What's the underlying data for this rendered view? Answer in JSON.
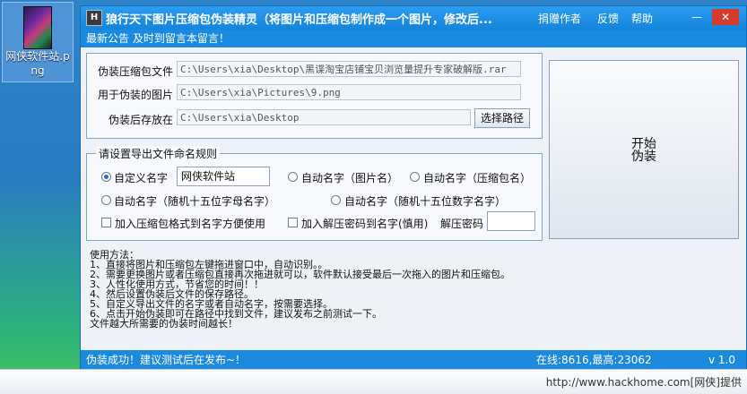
{
  "desktop": {
    "icon_label": "网侠软件站.png"
  },
  "window": {
    "title": "狼行天下图片压缩包伪装精灵（将图片和压缩包制作成一个图片，修改后...",
    "menu": [
      "捐赠作者",
      "反馈",
      "帮助"
    ],
    "controls": {
      "min": "—",
      "close": "✕"
    }
  },
  "notice": "最新公告 及时到留言本留言！",
  "files": {
    "archive_label": "伪装压缩包文件",
    "archive_path": "C:\\Users\\xia\\Desktop\\黑谍淘宝店铺宝贝浏览量提升专家破解版.rar",
    "image_label": "用于伪装的图片",
    "image_path": "C:\\Users\\xia\\Pictures\\9.png",
    "output_label": "伪装后存放在",
    "output_path": "C:\\Users\\xia\\Desktop",
    "choose_path_button": "选择路径"
  },
  "start_button": "开始伪装",
  "naming": {
    "group_title": "请设置导出文件命名规则",
    "custom_name_label": "自定义名字",
    "custom_name_value": "网侠软件站",
    "auto_image_label": "自动名字（图片名）",
    "auto_archive_label": "自动名字（压缩包名）",
    "auto_random_letters_label": "自动名字（随机十五位字母名字）",
    "auto_random_digits_label": "自动名字（随机十五位数字名字）",
    "add_format_label": "加入压缩包格式到名字方便使用",
    "add_password_label": "加入解压密码到名字(慎用)",
    "password_label": "解压密码",
    "password_value": ""
  },
  "instructions": {
    "title": "使用方法：",
    "lines": [
      "1、直接将图片和压缩包左键拖进窗口中，自动识别。。",
      "2、需要更换图片或者压缩包直接再次拖进就可以，软件默认接受最后一次拖入的图片和压缩包。",
      "3、人性化使用方式，节省您的时间！！",
      "4、然后设置伪装后文件的保存路径。",
      "5、自定义导出文件的名字或者自动名字，按需要选择。",
      "6、点击开始伪装即可在路径中找到文件，建议发布之前测试一下。",
      "文件越大所需要的伪装时间越长！"
    ]
  },
  "status": {
    "message": "伪装成功！建议测试后在发布~！",
    "online": "在线:8616,最高:23062",
    "version": "v 1.0"
  },
  "taskbar": {
    "watermark": "http://www.hackhome.com[网侠]提供"
  }
}
